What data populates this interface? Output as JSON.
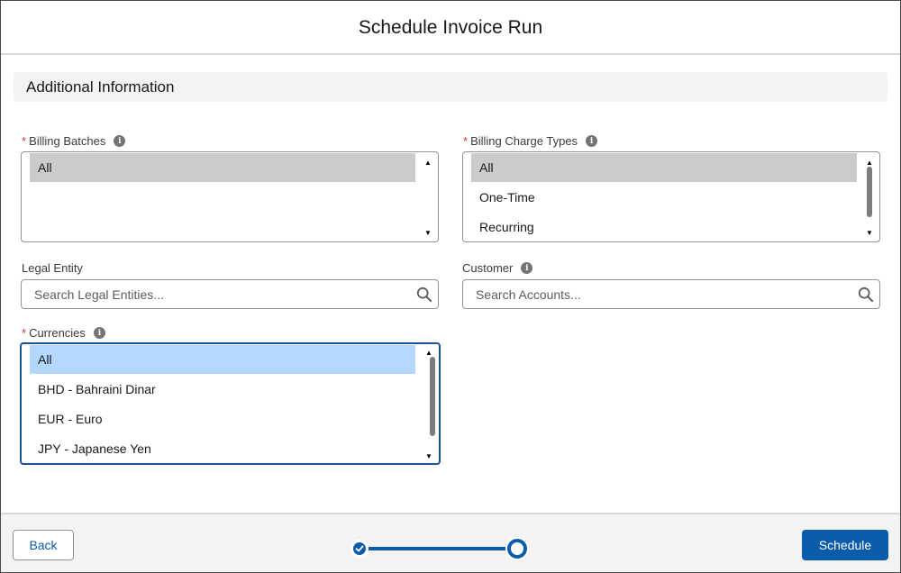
{
  "modal": {
    "title": "Schedule Invoice Run"
  },
  "section": {
    "title": "Additional Information"
  },
  "fields": {
    "billing_batches": {
      "label": "Billing Batches",
      "required": "*",
      "options": [
        "All"
      ],
      "selected": "All"
    },
    "billing_charge_types": {
      "label": "Billing Charge Types",
      "required": "*",
      "options": [
        "All",
        "One-Time",
        "Recurring"
      ],
      "selected": "All"
    },
    "legal_entity": {
      "label": "Legal Entity",
      "placeholder": "Search Legal Entities..."
    },
    "customer": {
      "label": "Customer",
      "placeholder": "Search Accounts..."
    },
    "currencies": {
      "label": "Currencies",
      "required": "*",
      "options": [
        "All",
        "BHD - Bahraini Dinar",
        "EUR - Euro",
        "JPY - Japanese Yen"
      ],
      "selected": "All"
    }
  },
  "footer": {
    "back_label": "Back",
    "schedule_label": "Schedule"
  },
  "icons": {
    "info": "info-icon",
    "search": "search-icon",
    "check": "check-icon"
  },
  "colors": {
    "brand": "#0b5cab",
    "required": "#c23934",
    "selected_option": "#cbcbcb",
    "focused_selected_option": "#b3d7ff"
  }
}
